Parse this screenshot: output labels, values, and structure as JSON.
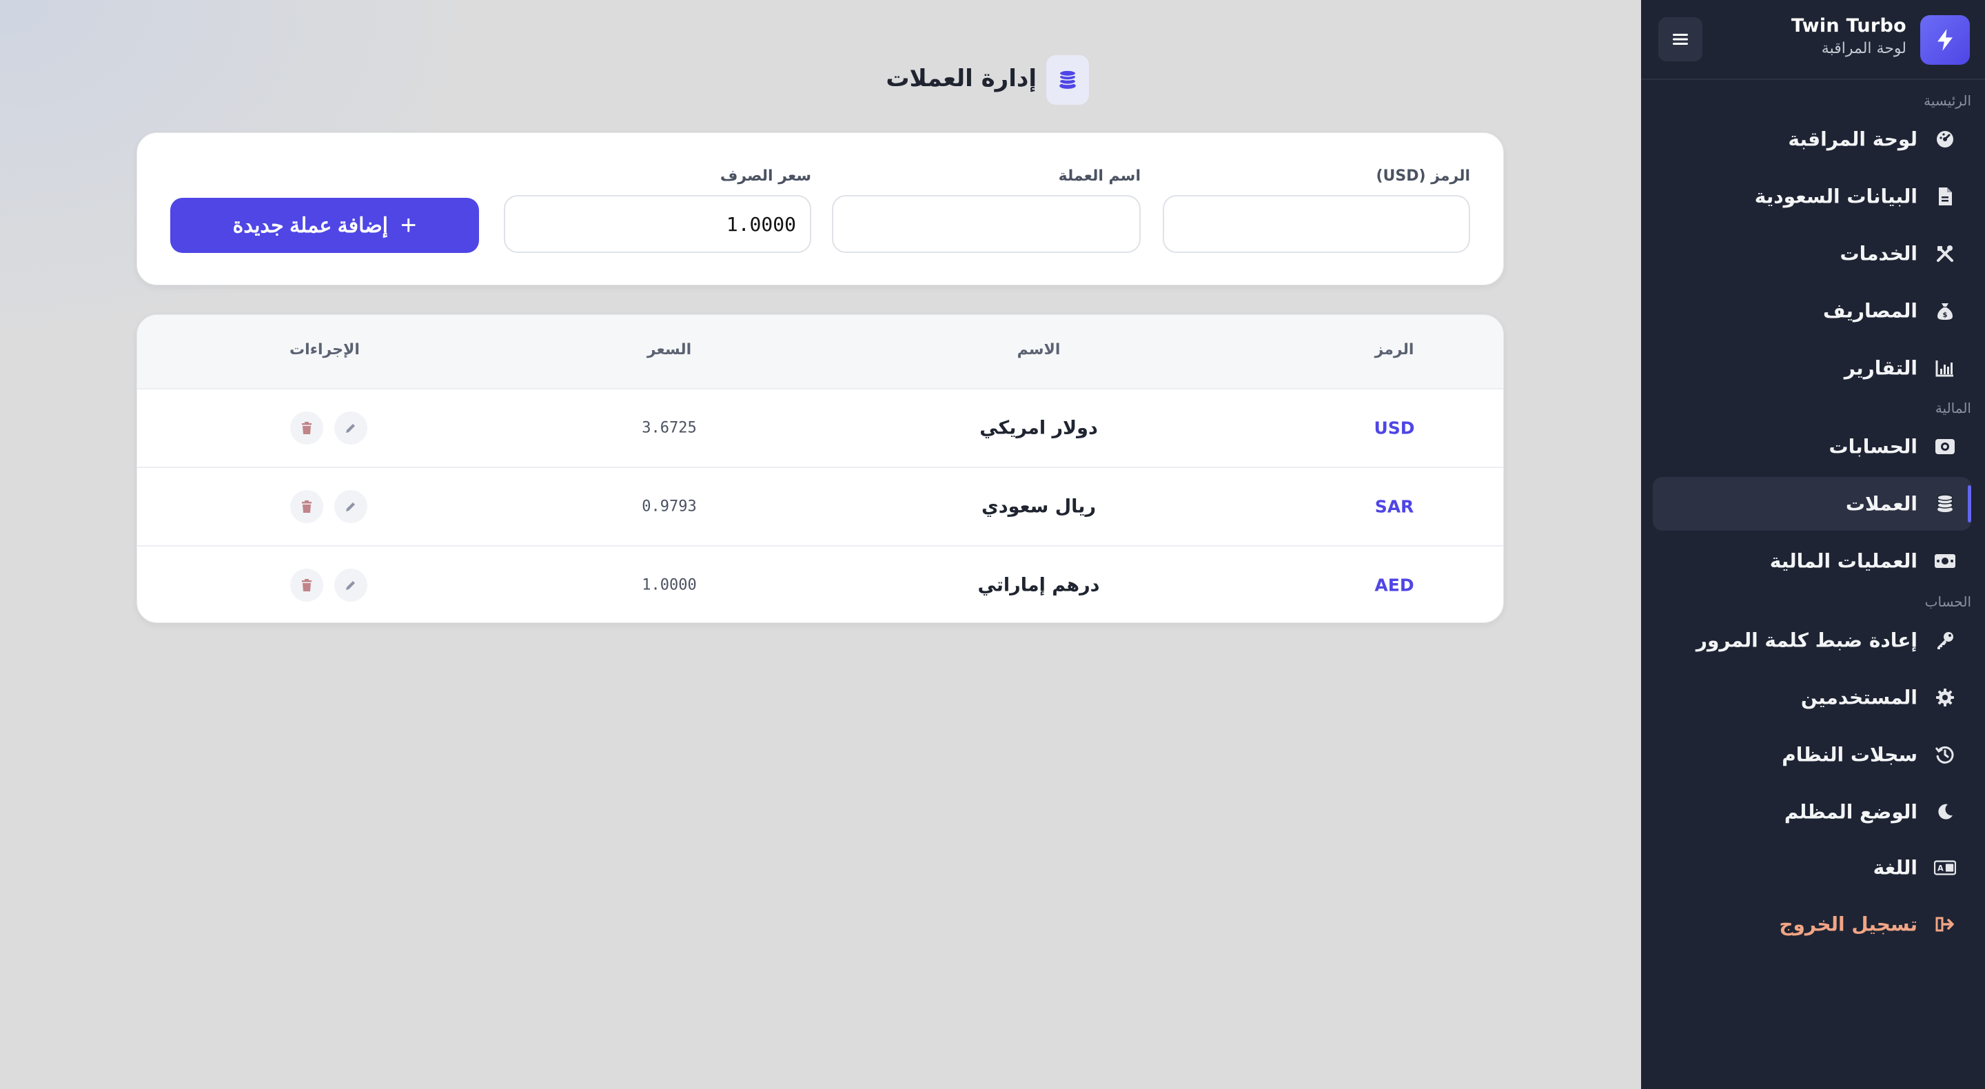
{
  "brand": {
    "title": "Twin Turbo",
    "subtitle": "لوحة المراقبة"
  },
  "sidebar": {
    "sections": [
      "الرئيسية",
      "المالية",
      "الحساب"
    ],
    "items": [
      {
        "label": "لوحة المراقبة",
        "icon": "gauge-icon"
      },
      {
        "label": "البيانات السعودية",
        "icon": "document-icon"
      },
      {
        "label": "الخدمات",
        "icon": "tools-icon"
      },
      {
        "label": "المصاريف",
        "icon": "money-bag-icon"
      },
      {
        "label": "التقارير",
        "icon": "bar-chart-icon"
      },
      {
        "label": "الحسابات",
        "icon": "wallet-icon"
      },
      {
        "label": "العملات",
        "icon": "coins-icon"
      },
      {
        "label": "العمليات المالية",
        "icon": "money-bill-icon"
      },
      {
        "label": "إعادة ضبط كلمة المرور",
        "icon": "key-icon"
      },
      {
        "label": "المستخدمين",
        "icon": "gear-icon"
      },
      {
        "label": "سجلات النظام",
        "icon": "history-icon"
      },
      {
        "label": "الوضع المظلم",
        "icon": "moon-icon"
      },
      {
        "label": "اللغة",
        "icon": "language-icon"
      },
      {
        "label": "تسجيل الخروج",
        "icon": "logout-icon"
      }
    ]
  },
  "page": {
    "title": "إدارة العملات"
  },
  "form": {
    "code_label": "الرمز (USD)",
    "code_value": "",
    "name_label": "اسم العملة",
    "name_value": "",
    "rate_label": "سعر الصرف",
    "rate_value": "1.0000",
    "add_button": "إضافة عملة جديدة"
  },
  "table": {
    "headers": {
      "code": "الرمز",
      "name": "الاسم",
      "rate": "السعر",
      "actions": "الإجراءات"
    },
    "rows": [
      {
        "code": "USD",
        "name": "دولار امريكي",
        "rate": "3.6725"
      },
      {
        "code": "SAR",
        "name": "ريال سعودي",
        "rate": "0.9793"
      },
      {
        "code": "AED",
        "name": "درهم إماراتي",
        "rate": "1.0000"
      }
    ]
  },
  "colors": {
    "accent": "#4f46e5",
    "sidebar_bg": "#1e2433",
    "logout": "#f2a585",
    "delete": "#c0848a"
  }
}
